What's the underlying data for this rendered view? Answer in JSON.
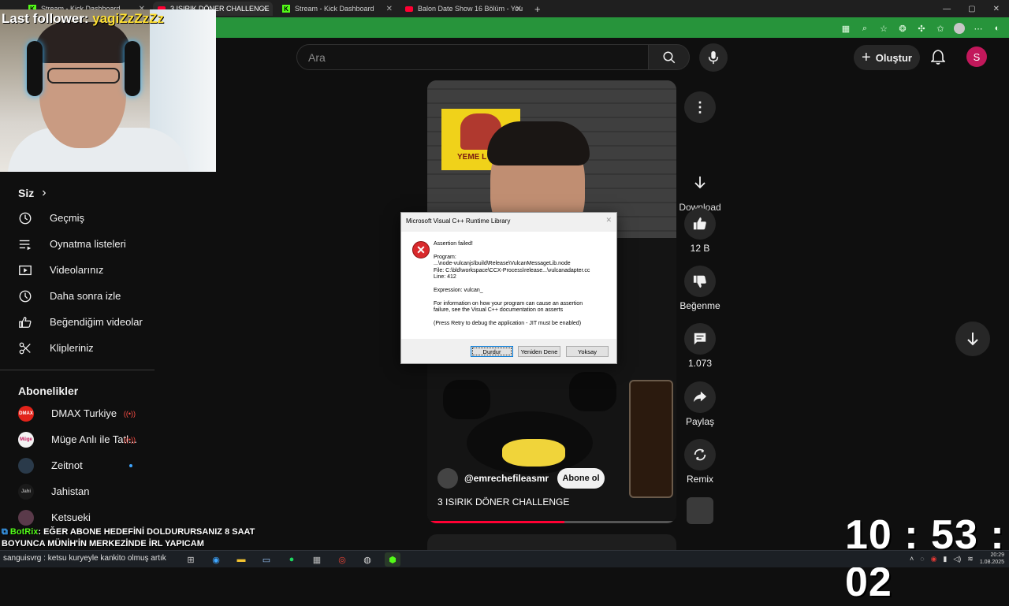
{
  "browser": {
    "tabs": [
      {
        "label": "Stream - Kick Dashboard",
        "icon": "kick-icon",
        "active": false
      },
      {
        "label": "3 ISIRIK DÖNER CHALLENGE",
        "icon": "youtube-icon",
        "active": true
      },
      {
        "label": "Stream - Kick Dashboard",
        "icon": "kick-icon",
        "active": false
      },
      {
        "label": "Balon Date Show 16 Bölüm - You",
        "icon": "youtube-icon",
        "active": false
      }
    ],
    "new_tab": "+",
    "window_controls": [
      "—",
      "▢",
      "✕"
    ]
  },
  "overlay": {
    "last_follower_label": "Last follower: ",
    "last_follower_name": "yagiZzZzZz",
    "chat_user": "BotRix",
    "chat_message": ": EĞER ABONE HEDEFİNİ DOLDURURSANIZ 8 SAAT BOYUNCA MÜNİH'İN MERKEZİNDE İRL YAPICAM",
    "clock": "10 : 53 : 02"
  },
  "header": {
    "search_placeholder": "Ara",
    "create_label": "Oluştur",
    "avatar_letter": "S"
  },
  "sidebar": {
    "you_heading": "Siz",
    "you_chevron": "›",
    "items": [
      {
        "label": "Geçmiş",
        "icon": "history-icon"
      },
      {
        "label": "Oynatma listeleri",
        "icon": "playlists-icon"
      },
      {
        "label": "Videolarınız",
        "icon": "your-videos-icon"
      },
      {
        "label": "Daha sonra izle",
        "icon": "watch-later-icon"
      },
      {
        "label": "Beğendiğim videolar",
        "icon": "liked-videos-icon"
      },
      {
        "label": "Klipleriniz",
        "icon": "clips-icon"
      }
    ],
    "subs_heading": "Abonelikler",
    "subscriptions": [
      {
        "label": "DMAX Turkiye",
        "avatar_text": "DMAX",
        "avatar_color": "#e2231a",
        "status": "live"
      },
      {
        "label": "Müge Anlı ile Tatl...",
        "avatar_text": "Müge",
        "avatar_color": "#f2f2f2",
        "status": "live"
      },
      {
        "label": "Zeitnot",
        "avatar_text": "",
        "avatar_color": "#2a3a4a",
        "status": "new"
      },
      {
        "label": "Jahistan",
        "avatar_text": "Jahi",
        "avatar_color": "#1a1a1a",
        "status": ""
      },
      {
        "label": "Ketsueki",
        "avatar_text": "",
        "avatar_color": "#5a3a4a",
        "status": ""
      }
    ]
  },
  "short": {
    "poster_text": "YEME L",
    "channel": "@emrechefileasmr",
    "subscribe_label": "Abone ol",
    "title": "3 ISIRIK DÖNER CHALLENGE",
    "progress": 0.55
  },
  "actions": {
    "download": "Download",
    "likes": "12 B",
    "dislike": "Beğenme",
    "comments": "1.073",
    "share": "Paylaş",
    "remix": "Remix"
  },
  "dialog": {
    "title": "Microsoft Visual C++ Runtime Library",
    "close": "✕",
    "heading": "Assertion failed!",
    "program": "Program:\n...\\node-vulcanjs\\build\\Release\\VulcanMessageLib.node\nFile: C:\\bld\\workspace\\CCX-Process\\release...\\vulcanadapter.cc\nLine: 412",
    "expression": "Expression: vulcan_",
    "info": "For information on how your program can cause an assertion\nfailure, see the Visual C++ documentation on asserts",
    "hint": "(Press Retry to debug the application - JIT must be enabled)",
    "buttons": {
      "abort": "Durdur",
      "retry": "Yeniden Dene",
      "ignore": "Yoksay"
    }
  },
  "taskbar": {
    "ticker": "sanguisvrg : ketsu kuryeyle kankito olmuş artık",
    "tray_time": "20:29",
    "tray_date": "1.08.2025"
  }
}
